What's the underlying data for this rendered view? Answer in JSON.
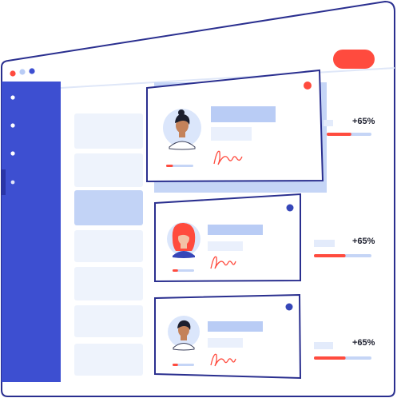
{
  "colors": {
    "frame_stroke": "#2a2f8f",
    "sidebar": "#3d4fd1",
    "accent_red": "#ff4b3e",
    "light_blue": "#b9ccf5",
    "pale_blue": "#eaf0fc",
    "navy_dot": "#3646b8"
  },
  "window": {
    "controls": [
      "close-dot",
      "minimize-dot",
      "maximize-dot"
    ],
    "header_button_icon": "red-pill-button"
  },
  "sidebar": {
    "items": [
      {
        "icon": "nav-dot",
        "active": false
      },
      {
        "icon": "nav-dot",
        "active": false
      },
      {
        "icon": "nav-dot",
        "active": false
      },
      {
        "icon": "nav-dot",
        "active": true
      }
    ]
  },
  "cards": [
    {
      "status_dot": "red",
      "avatar": "person-with-dark-hair-icon",
      "signature": "signature-icon",
      "progress": 0.25
    },
    {
      "status_dot": "navy",
      "avatar": "person-with-red-hair-icon",
      "signature": "signature-icon",
      "progress": 0.25
    },
    {
      "status_dot": "navy",
      "avatar": "person-with-dark-hair-icon",
      "signature": "signature-icon",
      "progress": 0.25
    }
  ],
  "stats": [
    {
      "label": "+65%",
      "progress": 0.55
    },
    {
      "label": "+65%",
      "progress": 0.55
    },
    {
      "label": "+65%",
      "progress": 0.55
    }
  ]
}
